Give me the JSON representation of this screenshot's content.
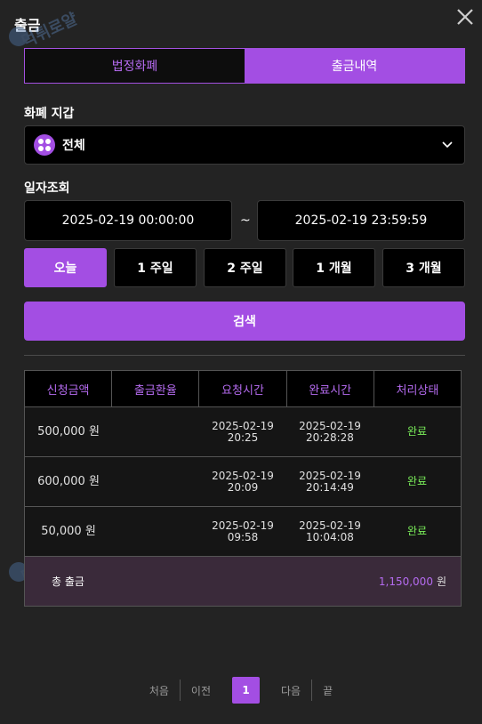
{
  "header": {
    "title": "출금",
    "watermark_text": "먹튀로얄"
  },
  "tabs": [
    {
      "label": "법정화폐",
      "active": false
    },
    {
      "label": "출금내역",
      "active": true
    }
  ],
  "wallet": {
    "label": "화폐 지갑",
    "selected": "전체"
  },
  "date_filter": {
    "label": "일자조회",
    "from": "2025-02-19 00:00:00",
    "separator": "~",
    "to": "2025-02-19 23:59:59"
  },
  "periods": [
    {
      "label": "오늘",
      "active": true
    },
    {
      "label": "1 주일",
      "active": false
    },
    {
      "label": "2 주일",
      "active": false
    },
    {
      "label": "1 개월",
      "active": false
    },
    {
      "label": "3 개월",
      "active": false
    }
  ],
  "search_label": "검색",
  "table": {
    "headers": [
      "신청금액",
      "출금환율",
      "요청시간",
      "완료시간",
      "처리상태"
    ],
    "rows": [
      {
        "amount": "500,000 원",
        "rate": "",
        "request_date": "2025-02-19",
        "request_time": "20:25",
        "complete_date": "2025-02-19",
        "complete_time": "20:28:28",
        "status": "완료"
      },
      {
        "amount": "600,000 원",
        "rate": "",
        "request_date": "2025-02-19",
        "request_time": "20:09",
        "complete_date": "2025-02-19",
        "complete_time": "20:14:49",
        "status": "완료"
      },
      {
        "amount": "50,000 원",
        "rate": "",
        "request_date": "2025-02-19",
        "request_time": "09:58",
        "complete_date": "2025-02-19",
        "complete_time": "10:04:08",
        "status": "완료"
      }
    ],
    "total_label": "총 출금",
    "total_value": "1,150,000",
    "total_unit": "원"
  },
  "pagination": {
    "first": "처음",
    "prev": "이전",
    "current": "1",
    "next": "다음",
    "last": "끝"
  },
  "colors": {
    "accent": "#a34ee3",
    "background": "#232323",
    "status_done": "#7bf05a"
  }
}
